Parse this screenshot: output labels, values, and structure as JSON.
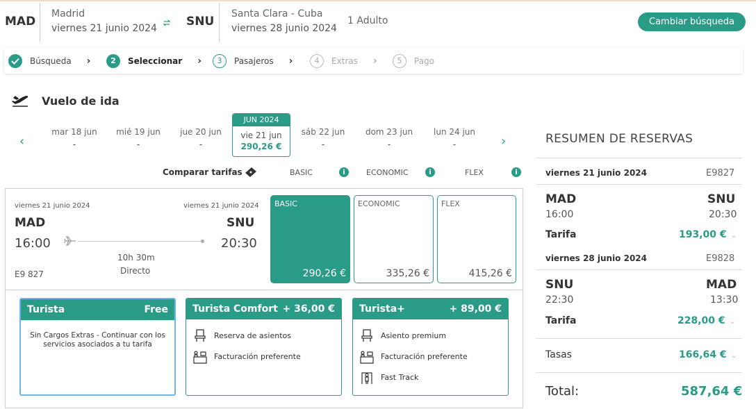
{
  "header": {
    "origin_code": "MAD",
    "origin_city": "Madrid",
    "depart_date": "viernes 21 junio 2024",
    "dest_code": "SNU",
    "dest_city": "Santa Clara - Cuba",
    "return_date": "viernes 28 junio 2024",
    "passengers": "1 Adulto",
    "change_button": "Cambiar búsqueda",
    "swap_icon": "swap-arrows-icon"
  },
  "stepper": [
    {
      "label": "Búsqueda",
      "num": "✓",
      "state": "done"
    },
    {
      "label": "Seleccionar",
      "num": "2",
      "state": "active"
    },
    {
      "label": "Pasajeros",
      "num": "3",
      "state": "next"
    },
    {
      "label": "Extras",
      "num": "4",
      "state": "disabled"
    },
    {
      "label": "Pago",
      "num": "5",
      "state": "disabled"
    }
  ],
  "section": {
    "title": "Vuelo de ida",
    "icon": "plane-takeoff-icon"
  },
  "dates": [
    {
      "label": "mar 18 jun",
      "price": "-"
    },
    {
      "label": "mié 19 jun",
      "price": "-"
    },
    {
      "label": "jue 20 jun",
      "price": "-"
    },
    {
      "month": "JUN 2024",
      "label": "vie 21 jun",
      "price": "290,26 €",
      "selected": true
    },
    {
      "label": "sáb 22 jun",
      "price": "-"
    },
    {
      "label": "dom 23 jun",
      "price": "-"
    },
    {
      "label": "lun 24 jun",
      "price": "-"
    }
  ],
  "compare": {
    "label": "Comparar tarifas",
    "fares": [
      "BASIC",
      "ECONOMIC",
      "FLEX"
    ]
  },
  "flight": {
    "dep_date": "viernes 21 junio 2024",
    "arr_date": "viernes 21 junio 2024",
    "origin": "MAD",
    "dest": "SNU",
    "dep_time": "16:00",
    "arr_time": "20:30",
    "duration": "10h 30m",
    "type": "Directo",
    "number": "E9 827",
    "fares": [
      {
        "name": "BASIC",
        "price": "290,26 €",
        "selected": true
      },
      {
        "name": "ECONOMIC",
        "price": "335,26 €"
      },
      {
        "name": "FLEX",
        "price": "415,26 €"
      }
    ]
  },
  "options": [
    {
      "name": "Turista",
      "price": "Free",
      "desc": "Sin Cargos Extras - Continuar con los servicios asociados a tu tarifa",
      "selected": true
    },
    {
      "name": "Turista Comfort",
      "price": "+ 36,00 €",
      "features": [
        "Reserva de asientos",
        "Facturación preferente"
      ]
    },
    {
      "name": "Turista+",
      "price": "+ 89,00 €",
      "features": [
        "Asiento premium",
        "Facturación preferente",
        "Fast Track"
      ]
    }
  ],
  "summary": {
    "title": "RESUMEN DE RESERVAS",
    "outbound": {
      "date": "viernes 21 junio 2024",
      "flight": "E9827",
      "from": "MAD",
      "to": "SNU",
      "dep": "16:00",
      "arr": "20:30",
      "fare_label": "Tarifa",
      "fare": "193,00 €"
    },
    "inbound": {
      "date": "viernes 28 junio 2024",
      "flight": "E9828",
      "from": "SNU",
      "to": "MAD",
      "dep": "22:30",
      "arr": "13:30",
      "fare_label": "Tarifa",
      "fare": "228,00 €"
    },
    "taxes_label": "Tasas",
    "taxes": "166,64 €",
    "total_label": "Total:",
    "total": "587,64 €"
  },
  "colors": {
    "accent": "#2a9b87",
    "selected_border": "#6fb5e3"
  }
}
